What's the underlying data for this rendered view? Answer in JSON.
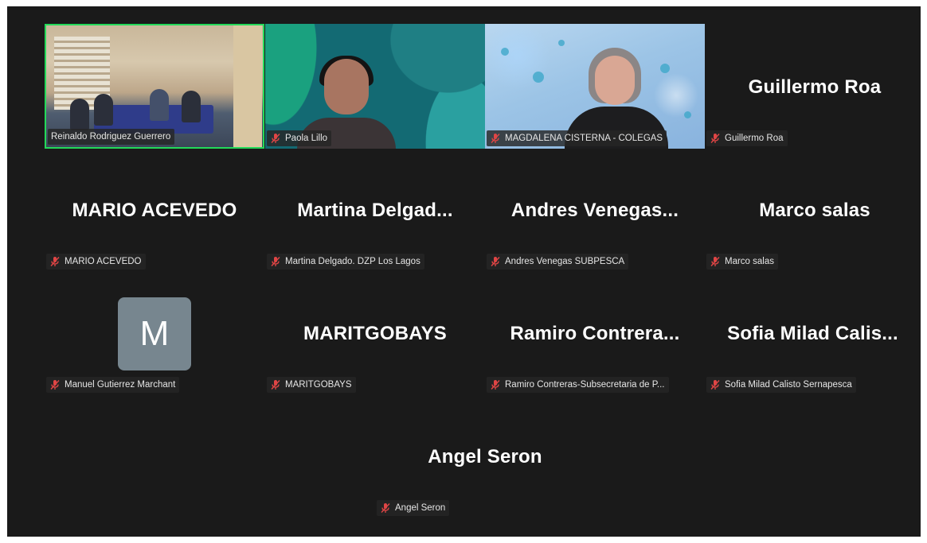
{
  "meeting": {
    "participants": [
      {
        "id": "reinaldo",
        "big_name": "",
        "label": "Reinaldo Rodriguez Guerrero",
        "muted": false,
        "video": true,
        "active_speaker": true
      },
      {
        "id": "paola",
        "big_name": "",
        "label": "Paola Lillo",
        "muted": true,
        "video": true
      },
      {
        "id": "magdalena",
        "big_name": "",
        "label": "MAGDALENA CISTERNA - COLEGAS",
        "muted": true,
        "video": true
      },
      {
        "id": "guillermo",
        "big_name": "Guillermo Roa",
        "label": "Guillermo Roa",
        "muted": true,
        "video": false
      },
      {
        "id": "mario",
        "big_name": "MARIO ACEVEDO",
        "label": "MARIO ACEVEDO",
        "muted": true,
        "video": false
      },
      {
        "id": "martina",
        "big_name": "Martina Delgad...",
        "label": "Martina Delgado. DZP Los Lagos",
        "muted": true,
        "video": false
      },
      {
        "id": "andres",
        "big_name": "Andres Venegas...",
        "label": "Andres Venegas SUBPESCA",
        "muted": true,
        "video": false
      },
      {
        "id": "marco",
        "big_name": "Marco salas",
        "label": "Marco salas",
        "muted": true,
        "video": false
      },
      {
        "id": "manuel",
        "big_name": "",
        "avatar_letter": "M",
        "label": "Manuel Gutierrez Marchant",
        "muted": true,
        "video": false
      },
      {
        "id": "maritgobays",
        "big_name": "MARITGOBAYS",
        "label": "MARITGOBAYS",
        "muted": true,
        "video": false
      },
      {
        "id": "ramiro",
        "big_name": "Ramiro Contrera...",
        "label": "Ramiro Contreras-Subsecretaria de P...",
        "muted": true,
        "video": false
      },
      {
        "id": "sofia",
        "big_name": "Sofia Milad Calis...",
        "label": "Sofia Milad Calisto Sernapesca",
        "muted": true,
        "video": false
      },
      {
        "id": "angel",
        "big_name": "Angel Seron",
        "label": "Angel Seron",
        "muted": true,
        "video": false
      }
    ]
  },
  "colors": {
    "background": "#1a1a1a",
    "active_speaker_border": "#23d959",
    "muted_icon": "#e04545",
    "avatar_bg": "#77868f"
  },
  "icons": {
    "muted": "microphone-muted-icon"
  }
}
